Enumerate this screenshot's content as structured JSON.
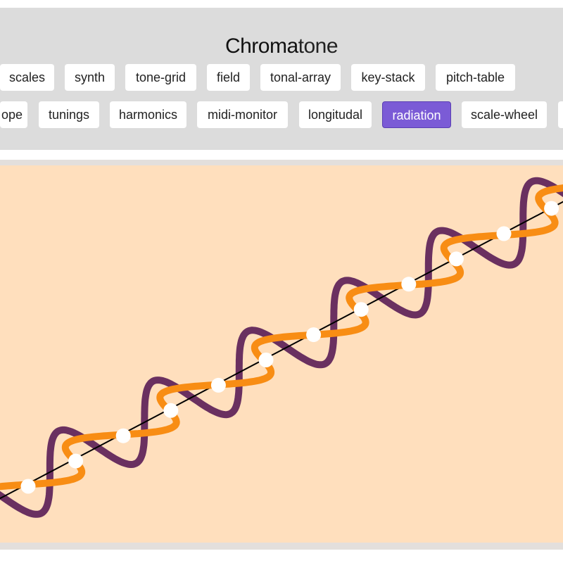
{
  "app": {
    "title_strong": "Chroma",
    "title_light": "tone"
  },
  "nav": {
    "row1": [
      "scales",
      "synth",
      "tone-grid",
      "field",
      "tonal-array",
      "key-stack",
      "pitch-table"
    ],
    "row2": [
      "ope",
      "tunings",
      "harmonics",
      "midi-monitor",
      "longitudal",
      "radiation",
      "scale-wheel",
      ""
    ],
    "active": "radiation"
  },
  "visualization": {
    "colors": {
      "background": "#ffdfbd",
      "strand_a": "#6a3060",
      "strand_b": "#f88d14",
      "axis": "#000000",
      "nodes": "#ffffff"
    },
    "node_count": 12
  }
}
